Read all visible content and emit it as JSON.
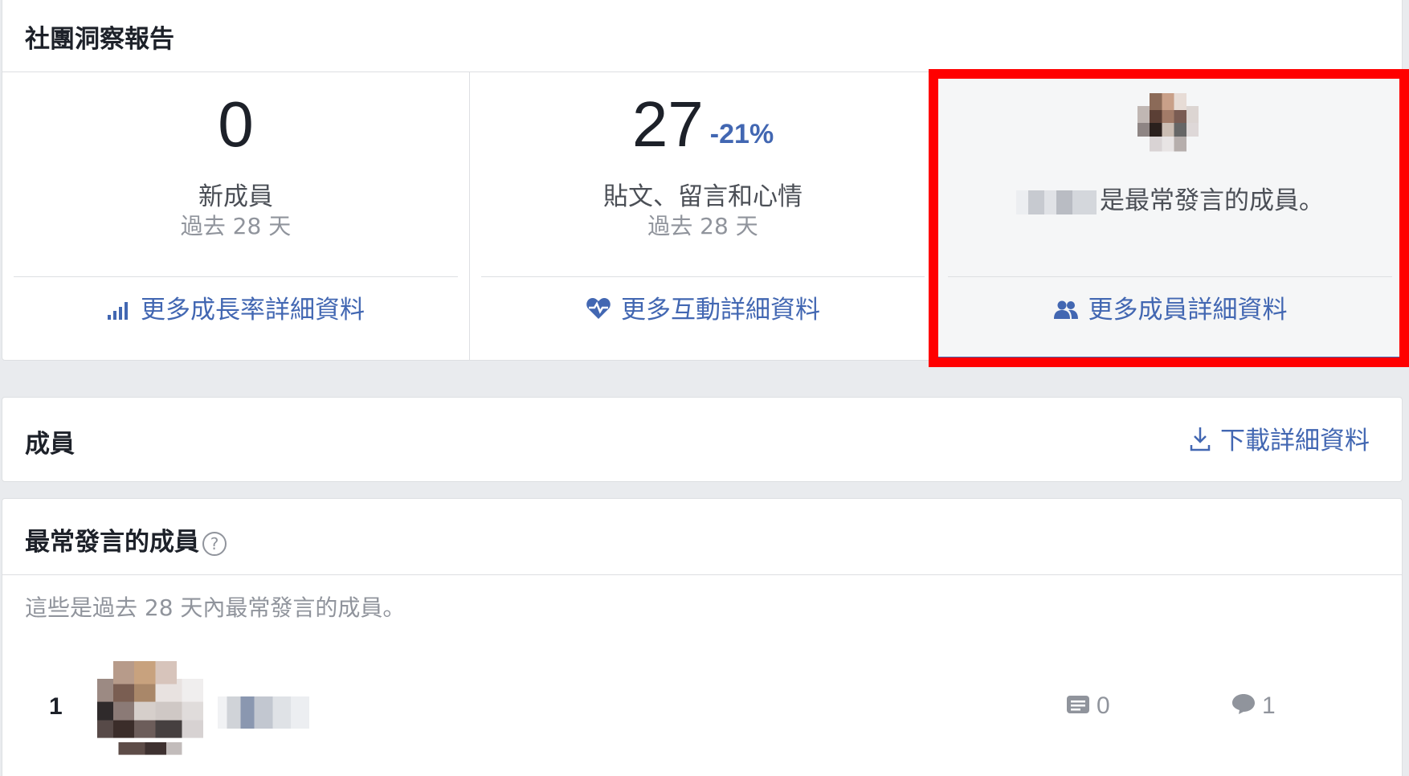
{
  "insights": {
    "title": "社團洞察報告",
    "new_members": {
      "value": "0",
      "label": "新成員",
      "period": "過去 28 天",
      "link": "更多成長率詳細資料",
      "link_icon": "bar-chart-icon"
    },
    "engagement": {
      "value": "27",
      "delta": "-21%",
      "label": "貼文、留言和心情",
      "period": "過去 28 天",
      "link": "更多互動詳細資料",
      "link_icon": "heart-pulse-icon"
    },
    "top_member": {
      "text": "是最常發言的成員。",
      "link": "更多成員詳細資料",
      "link_icon": "people-icon"
    }
  },
  "members": {
    "title": "成員",
    "download": "下載詳細資料",
    "download_icon": "download-icon"
  },
  "top_posters": {
    "title": "最常發言的成員",
    "help": "?",
    "description": "這些是過去 28 天內最常發言的成員。",
    "rows": [
      {
        "rank": "1",
        "posts": "0",
        "comments": "1"
      }
    ]
  },
  "colors": {
    "accent": "#4267b2",
    "highlight": "#ff0000",
    "background": "#e9ebee"
  }
}
